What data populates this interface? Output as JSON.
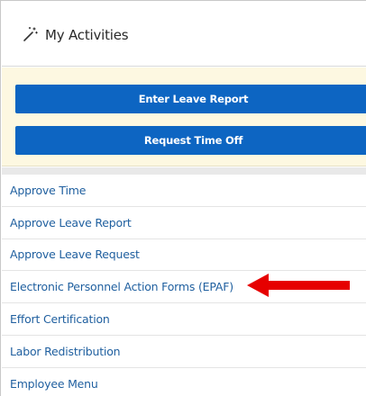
{
  "panel": {
    "title": "My Activities",
    "title_icon": "magic-wand-icon"
  },
  "actions": [
    {
      "label": "Enter Leave Report"
    },
    {
      "label": "Request Time Off"
    }
  ],
  "menu": {
    "items": [
      {
        "label": "Approve Time"
      },
      {
        "label": "Approve Leave Report"
      },
      {
        "label": "Approve Leave Request"
      },
      {
        "label": "Electronic Personnel Action Forms (EPAF)"
      },
      {
        "label": "Effort Certification"
      },
      {
        "label": "Labor Redistribution"
      },
      {
        "label": "Employee Menu"
      }
    ]
  },
  "annotation": {
    "arrow_icon": "red-arrow-left-icon",
    "arrow_color": "#e60000"
  },
  "colors": {
    "button_bg": "#0d65c2",
    "actions_bg": "#fdf8e1",
    "link_color": "#1f5f9f"
  }
}
